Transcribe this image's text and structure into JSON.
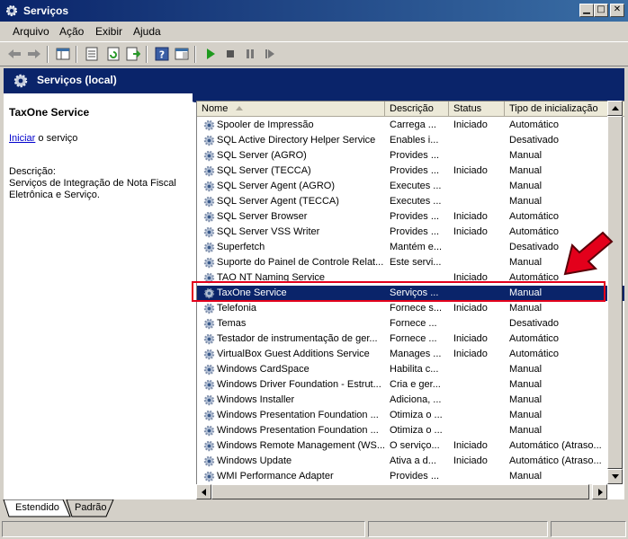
{
  "window": {
    "title": "Serviços"
  },
  "menu": [
    "Arquivo",
    "Ação",
    "Exibir",
    "Ajuda"
  ],
  "toolbar_icons": [
    "back-arrow-icon",
    "forward-arrow-icon",
    "console-tree-icon",
    "properties-icon",
    "refresh-icon",
    "export-list-icon",
    "help-icon",
    "view-icon",
    "play-icon",
    "stop-icon",
    "pause-icon",
    "restart-icon"
  ],
  "band": {
    "title": "Serviços (local)"
  },
  "left_pane": {
    "service_name": "TaxOne Service",
    "action_link": "Iniciar",
    "action_suffix": " o serviço",
    "description_label": "Descrição:",
    "description_text": "Serviços de Integração de Nota Fiscal Eletrônica e Serviço."
  },
  "columns": {
    "name": "Nome",
    "description": "Descrição",
    "status": "Status",
    "startup": "Tipo de inicialização"
  },
  "services": [
    {
      "name": "Spooler de Impressão",
      "desc": "Carrega ...",
      "status": "Iniciado",
      "type": "Automático"
    },
    {
      "name": "SQL Active Directory Helper Service",
      "desc": "Enables i...",
      "status": "",
      "type": "Desativado"
    },
    {
      "name": "SQL Server (AGRO)",
      "desc": "Provides ...",
      "status": "",
      "type": "Manual"
    },
    {
      "name": "SQL Server (TECCA)",
      "desc": "Provides ...",
      "status": "Iniciado",
      "type": "Manual"
    },
    {
      "name": "SQL Server Agent (AGRO)",
      "desc": "Executes ...",
      "status": "",
      "type": "Manual"
    },
    {
      "name": "SQL Server Agent (TECCA)",
      "desc": "Executes ...",
      "status": "",
      "type": "Manual"
    },
    {
      "name": "SQL Server Browser",
      "desc": "Provides ...",
      "status": "Iniciado",
      "type": "Automático"
    },
    {
      "name": "SQL Server VSS Writer",
      "desc": "Provides ...",
      "status": "Iniciado",
      "type": "Automático"
    },
    {
      "name": "Superfetch",
      "desc": "Mantém e...",
      "status": "",
      "type": "Desativado"
    },
    {
      "name": "Suporte do Painel de Controle Relat...",
      "desc": "Este servi...",
      "status": "",
      "type": "Manual"
    },
    {
      "name": "TAO NT Naming Service",
      "desc": "",
      "status": "Iniciado",
      "type": "Automático"
    },
    {
      "name": "TaxOne Service",
      "desc": "Serviços ...",
      "status": "",
      "type": "Manual",
      "selected": true
    },
    {
      "name": "Telefonia",
      "desc": "Fornece s...",
      "status": "Iniciado",
      "type": "Manual"
    },
    {
      "name": "Temas",
      "desc": "Fornece ...",
      "status": "",
      "type": "Desativado"
    },
    {
      "name": "Testador de instrumentação de ger...",
      "desc": "Fornece ...",
      "status": "Iniciado",
      "type": "Automático"
    },
    {
      "name": "VirtualBox Guest Additions Service",
      "desc": "Manages ...",
      "status": "Iniciado",
      "type": "Automático"
    },
    {
      "name": "Windows CardSpace",
      "desc": "Habilita c...",
      "status": "",
      "type": "Manual"
    },
    {
      "name": "Windows Driver Foundation - Estrut...",
      "desc": "Cria e ger...",
      "status": "",
      "type": "Manual"
    },
    {
      "name": "Windows Installer",
      "desc": "Adiciona, ...",
      "status": "",
      "type": "Manual"
    },
    {
      "name": "Windows Presentation Foundation ...",
      "desc": "Otimiza o ...",
      "status": "",
      "type": "Manual"
    },
    {
      "name": "Windows Presentation Foundation ...",
      "desc": "Otimiza o ...",
      "status": "",
      "type": "Manual"
    },
    {
      "name": "Windows Remote Management (WS...",
      "desc": "O serviço...",
      "status": "Iniciado",
      "type": "Automático (Atraso..."
    },
    {
      "name": "Windows Update",
      "desc": "Ativa a d...",
      "status": "Iniciado",
      "type": "Automático (Atraso..."
    },
    {
      "name": "WMI Performance Adapter",
      "desc": "Provides ...",
      "status": "",
      "type": "Manual"
    }
  ],
  "tabs": [
    "Estendido",
    "Padrão"
  ],
  "colors": {
    "selection": "#0a246a",
    "annotation": "#e3001b",
    "link": "#0000cc"
  }
}
